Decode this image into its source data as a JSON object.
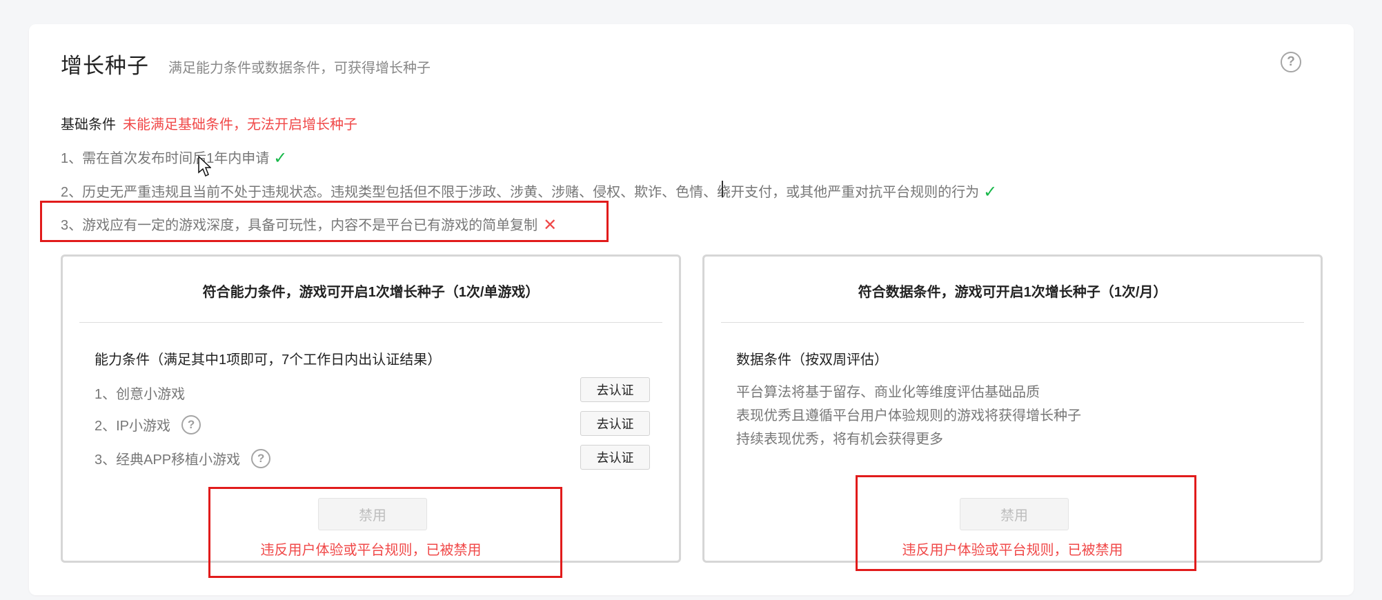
{
  "page": {
    "title": "增长种子",
    "subtitle": "满足能力条件或数据条件，可获得增长种子",
    "help_icon": "question-circle"
  },
  "base_conditions": {
    "label": "基础条件",
    "warning": "未能满足基础条件，无法开启增长种子",
    "rules": [
      {
        "text": "1、需在首次发布时间后1年内申请",
        "status": "check"
      },
      {
        "text": "2、历史无严重违规且当前不处于违规状态。违规类型包括但不限于涉政、涉黄、涉赌、侵权、欺诈、色情、绕开支付，或其他严重对抗平台规则的行为",
        "status": "check"
      },
      {
        "text": "3、游戏应有一定的游戏深度，具备可玩性，内容不是平台已有游戏的简单复制",
        "status": "cross"
      }
    ],
    "check_glyph": "✓",
    "cross_glyph": "✕"
  },
  "ability_panel": {
    "title": "符合能力条件，游戏可开启1次增长种子（1次/单游戏）",
    "section_title": "能力条件（满足其中1项即可，7个工作日内出认证结果）",
    "items": [
      {
        "label": "1、创意小游戏",
        "has_help": false,
        "button": "去认证"
      },
      {
        "label": "2、IP小游戏",
        "has_help": true,
        "button": "去认证"
      },
      {
        "label": "3、经典APP移植小游戏",
        "has_help": true,
        "button": "去认证"
      }
    ],
    "disabled_button": "禁用",
    "ban_message": "违反用户体验或平台规则，已被禁用"
  },
  "data_panel": {
    "title": "符合数据条件，游戏可开启1次增长种子（1次/月）",
    "section_title": "数据条件（按双周评估）",
    "lines": [
      "平台算法将基于留存、商业化等维度评估基础品质",
      "表现优秀且遵循平台用户体验规则的游戏将获得增长种子",
      "持续表现优秀，将有机会获得更多"
    ],
    "disabled_button": "禁用",
    "ban_message": "违反用户体验或平台规则，已被禁用"
  },
  "colors": {
    "accent_red": "#f04848",
    "highlight_red": "#e11b1b",
    "success_green": "#18b84a",
    "muted_text": "#777777",
    "border": "#d6d6d6"
  }
}
